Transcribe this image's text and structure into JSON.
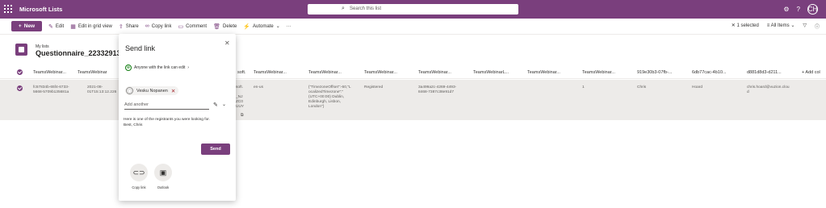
{
  "suite": {
    "app_title": "Microsoft Lists",
    "search_placeholder": "Search this list",
    "avatar_initials": "CH"
  },
  "commands": {
    "new_label": "New",
    "items": [
      {
        "label": "Edit",
        "icon": "pencil-icon"
      },
      {
        "label": "Edit in grid view",
        "icon": "grid-icon"
      },
      {
        "label": "Share",
        "icon": "share-icon"
      },
      {
        "label": "Copy link",
        "icon": "link-icon"
      },
      {
        "label": "Comment",
        "icon": "comment-icon"
      },
      {
        "label": "Delete",
        "icon": "trash-icon"
      },
      {
        "label": "Automate",
        "icon": "flow-icon"
      }
    ],
    "more": "···",
    "selected_count": "1 selected",
    "view_name": "All Items"
  },
  "list": {
    "breadcrumb": "My lists",
    "title": "Questionnaire_22332913-3fe"
  },
  "table": {
    "headers": [
      "TeamsWebinar...",
      "TeamsWebinar",
      "soft.",
      "TeamsWebinar...",
      "TeamsWebinar...",
      "TeamsWebinar...",
      "TeamsWebinar...",
      "TeamsWebinarL...",
      "TeamsWebinar...",
      "TeamsWebinar...",
      "919e30b3-07fb-...",
      "6db77cac-4b10...",
      "d881d8d3-d211...",
      "+ Add col"
    ],
    "row": {
      "c1": "fc57834b-65f4-6733-\n5668-5709b135681a",
      "c2": "2021-08-\n01T15:13:12.226",
      "c3": "soft.\n\n_NJ\nZC0\nUUY",
      "c4": "en-us",
      "c5": "{\"TimezoneOffset\":-60,\"L\nocalizedTimezone\":\"\n(UTC+00:00) Dublin,\nEdinburgh, Lisbon,\nLondon\"}",
      "c6": "Registered",
      "c7": "3a499a2c-4269-4493-\n8468-7387c38e91d7",
      "c8": "1",
      "c9": "Chris",
      "c10": "Hoard",
      "c11": "chris.hoard@vuzion.clou\nd"
    }
  },
  "panel": {
    "title": "Send link",
    "permission": "Anyone with the link can edit",
    "recipient": "Vesku Nopanen",
    "add_placeholder": "Add another",
    "message": "Here is one of the registrants you were looking for.\nBest, Chris",
    "send_label": "Send",
    "options": [
      {
        "label": "Copy link",
        "icon": "link-icon"
      },
      {
        "label": "Outlook",
        "icon": "outlook-icon"
      }
    ]
  }
}
